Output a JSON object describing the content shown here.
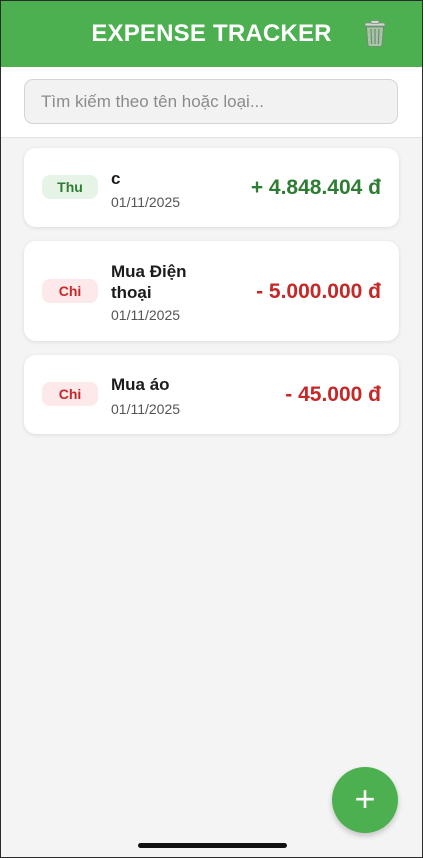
{
  "header": {
    "title": "EXPENSE TRACKER",
    "trash_icon": "trash-icon"
  },
  "search": {
    "placeholder": "Tìm kiếm theo tên hoặc loại...",
    "value": ""
  },
  "transactions": [
    {
      "type": "Thu",
      "kind": "income",
      "title": "c",
      "date": "01/11/2025",
      "amount": "+ 4.848.404 đ"
    },
    {
      "type": "Chi",
      "kind": "expense",
      "title": "Mua Điện thoại",
      "date": "01/11/2025",
      "amount": "- 5.000.000 đ"
    },
    {
      "type": "Chi",
      "kind": "expense",
      "title": "Mua áo",
      "date": "01/11/2025",
      "amount": "- 45.000 đ"
    }
  ],
  "fab": {
    "label": "+",
    "icon": "plus-icon"
  },
  "colors": {
    "primary": "#4caf50",
    "income": "#2e7d32",
    "expense": "#c62828"
  }
}
